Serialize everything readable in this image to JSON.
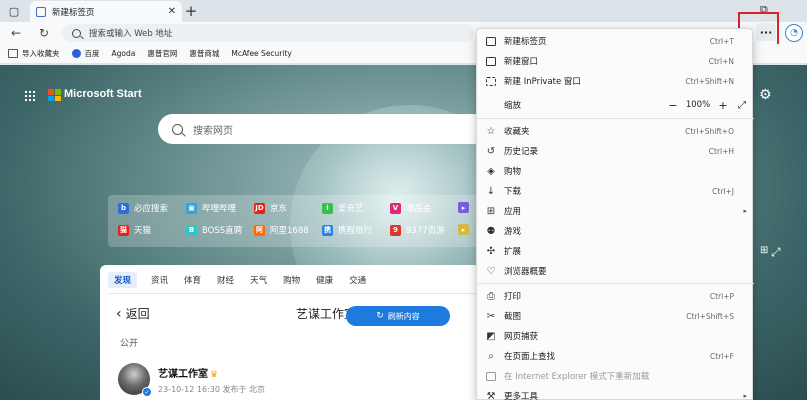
{
  "tab": {
    "title": "新建标签页"
  },
  "address_bar": {
    "placeholder": "搜索或输入 Web 地址"
  },
  "favorites": [
    {
      "label": "导入收藏夹",
      "icon": "folder-icon"
    },
    {
      "label": "百度",
      "icon": "baidu-icon"
    },
    {
      "label": "Agoda",
      "icon": "page-icon"
    },
    {
      "label": "惠普官网",
      "icon": "page-icon"
    },
    {
      "label": "惠普商城",
      "icon": "page-icon"
    },
    {
      "label": "McAfee Security",
      "icon": "page-icon"
    }
  ],
  "start": {
    "brand": "Microsoft Start",
    "search_placeholder": "搜索网页",
    "quicklinks": [
      {
        "label": "必应搜索",
        "color": "#2a6fdb",
        "glyph": "b"
      },
      {
        "label": "哔哩哔哩",
        "color": "#29a6e0",
        "glyph": "▣"
      },
      {
        "label": "京东",
        "color": "#e1251b",
        "glyph": "JD"
      },
      {
        "label": "爱奇艺",
        "color": "#37c04b",
        "glyph": "i"
      },
      {
        "label": "唯品会",
        "color": "#e0287b",
        "glyph": "V"
      },
      {
        "label": "天猫",
        "color": "#e1251b",
        "glyph": "猫"
      },
      {
        "label": "BOSS直聘",
        "color": "#2ec5c5",
        "glyph": "B"
      },
      {
        "label": "阿里1688",
        "color": "#ff6a00",
        "glyph": "阿"
      },
      {
        "label": "携程旅行",
        "color": "#2a82e4",
        "glyph": "携"
      },
      {
        "label": "9377页游",
        "color": "#d63a2a",
        "glyph": "9"
      }
    ]
  },
  "feed": {
    "tabs": [
      "发现",
      "资讯",
      "体育",
      "财经",
      "天气",
      "购物",
      "健康",
      "交通"
    ],
    "back_label": "返回",
    "channel_title": "艺谋工作室",
    "refresh_label": "刷新内容",
    "visibility": "公开",
    "author_name": "艺谋工作室",
    "author_meta": "23-10-12 16:30 发布于 北京"
  },
  "menu": {
    "items": [
      {
        "label": "新建标签页",
        "shortcut": "Ctrl+T",
        "icon": "new-tab-icon"
      },
      {
        "label": "新建窗口",
        "shortcut": "Ctrl+N",
        "icon": "new-window-icon"
      },
      {
        "label": "新建 InPrivate 窗口",
        "shortcut": "Ctrl+Shift+N",
        "icon": "inprivate-icon"
      },
      {
        "label": "缩放",
        "zoom_value": "100%",
        "icon": ""
      },
      {
        "label": "收藏夹",
        "shortcut": "Ctrl+Shift+O",
        "icon": "favorites-icon"
      },
      {
        "label": "历史记录",
        "shortcut": "Ctrl+H",
        "icon": "history-icon"
      },
      {
        "label": "购物",
        "shortcut": "",
        "icon": "shopping-icon"
      },
      {
        "label": "下载",
        "shortcut": "Ctrl+J",
        "icon": "download-icon"
      },
      {
        "label": "应用",
        "shortcut": "",
        "icon": "apps-icon"
      },
      {
        "label": "游戏",
        "shortcut": "",
        "icon": "games-icon"
      },
      {
        "label": "扩展",
        "shortcut": "",
        "icon": "extensions-icon"
      },
      {
        "label": "浏览器概要",
        "shortcut": "",
        "icon": "browser-essentials-icon"
      },
      {
        "label": "打印",
        "shortcut": "Ctrl+P",
        "icon": "print-icon"
      },
      {
        "label": "截图",
        "shortcut": "Ctrl+Shift+S",
        "icon": "screenshot-icon"
      },
      {
        "label": "网页捕获",
        "shortcut": "",
        "icon": "web-capture-icon"
      },
      {
        "label": "在页面上查找",
        "shortcut": "Ctrl+F",
        "icon": "find-icon"
      },
      {
        "label": "在 Internet Explorer 模式下重新加载",
        "shortcut": "",
        "icon": "ie-mode-icon"
      },
      {
        "label": "更多工具",
        "shortcut": "",
        "icon": "more-tools-icon"
      }
    ]
  }
}
